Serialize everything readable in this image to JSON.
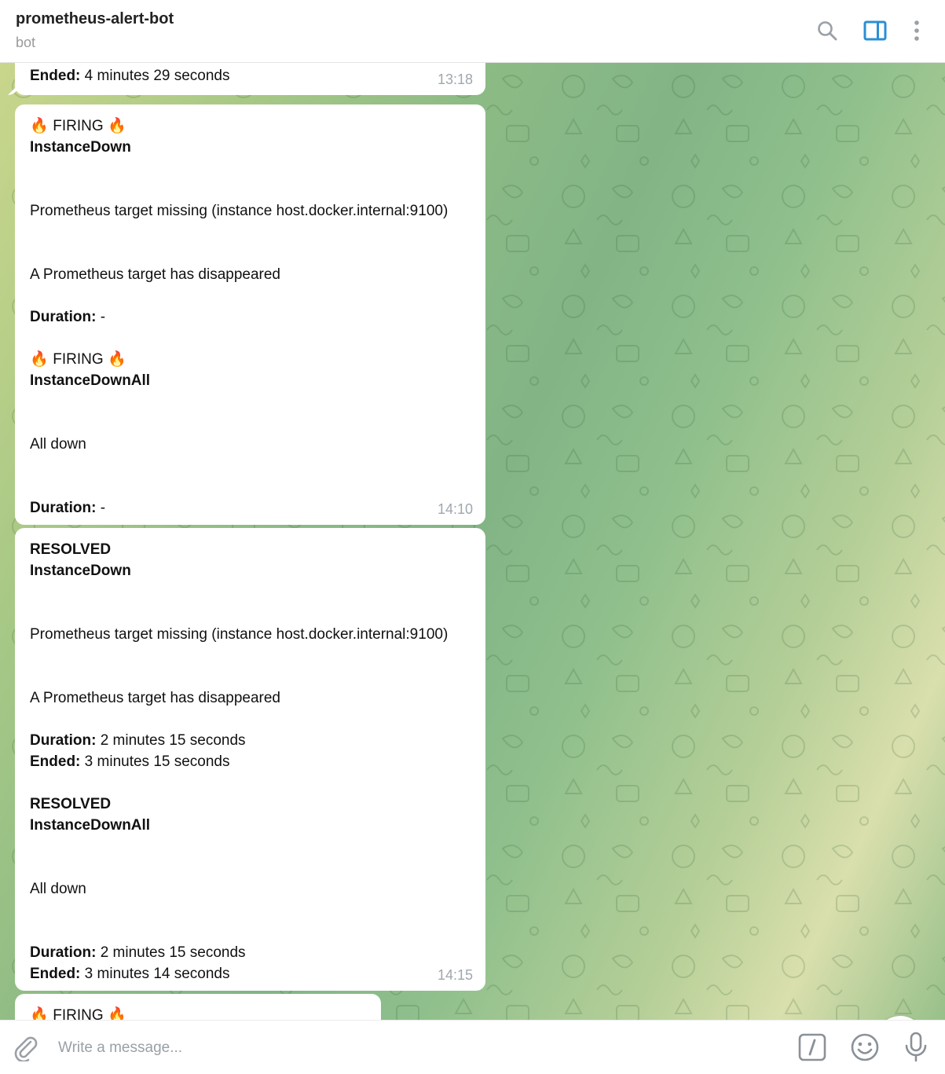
{
  "header": {
    "title": "prometheus-alert-bot",
    "subtitle": "bot"
  },
  "messages": [
    {
      "lines": [
        {
          "label": "Ended:",
          "text": " 4 minutes 29 seconds"
        }
      ],
      "time": "13:18"
    },
    {
      "lines": [
        {
          "fire": true,
          "text": "FIRING"
        },
        {
          "label": "InstanceDown",
          "text": ""
        },
        {
          "text": ""
        },
        {
          "text": ""
        },
        {
          "text": "Prometheus target missing (instance host.docker.internal:9100)"
        },
        {
          "text": ""
        },
        {
          "text": ""
        },
        {
          "text": "A Prometheus target has disappeared"
        },
        {
          "text": ""
        },
        {
          "label": "Duration:",
          "text": " -"
        },
        {
          "text": ""
        },
        {
          "fire": true,
          "text": "FIRING"
        },
        {
          "label": "InstanceDownAll",
          "text": ""
        },
        {
          "text": ""
        },
        {
          "text": ""
        },
        {
          "text": "All down"
        },
        {
          "text": ""
        },
        {
          "text": ""
        },
        {
          "label": "Duration:",
          "text": " -"
        }
      ],
      "time": "14:10"
    },
    {
      "lines": [
        {
          "label": "RESOLVED",
          "text": ""
        },
        {
          "label": "InstanceDown",
          "text": ""
        },
        {
          "text": ""
        },
        {
          "text": ""
        },
        {
          "text": "Prometheus target missing (instance host.docker.internal:9100)"
        },
        {
          "text": ""
        },
        {
          "text": ""
        },
        {
          "text": "A Prometheus target has disappeared"
        },
        {
          "text": ""
        },
        {
          "label": "Duration:",
          "text": " 2 minutes 15 seconds"
        },
        {
          "label": "Ended:",
          "text": " 3 minutes 15 seconds"
        },
        {
          "text": ""
        },
        {
          "label": "RESOLVED",
          "text": ""
        },
        {
          "label": "InstanceDownAll",
          "text": ""
        },
        {
          "text": ""
        },
        {
          "text": ""
        },
        {
          "text": "All down"
        },
        {
          "text": ""
        },
        {
          "text": ""
        },
        {
          "label": "Duration:",
          "text": " 2 minutes 15 seconds"
        },
        {
          "label": "Ended:",
          "text": " 3 minutes 14 seconds"
        }
      ],
      "time": "14:15"
    },
    {
      "lines": [
        {
          "fire": true,
          "text": "FIRING"
        }
      ],
      "time": ""
    }
  ],
  "composer": {
    "placeholder": "Write a message..."
  },
  "icons": {
    "header": [
      "search-icon",
      "side-panel-icon",
      "more-vertical-icon"
    ],
    "composer": [
      "attach-icon",
      "bot-command-icon",
      "emoji-icon",
      "microphone-icon"
    ],
    "scroll": "chevron-down-icon",
    "fire": "fire-icon"
  },
  "colors": {
    "accent": "#2b8fd6",
    "bubble": "#ffffff",
    "time": "#a0a7ad",
    "fire": "#e8551f"
  }
}
